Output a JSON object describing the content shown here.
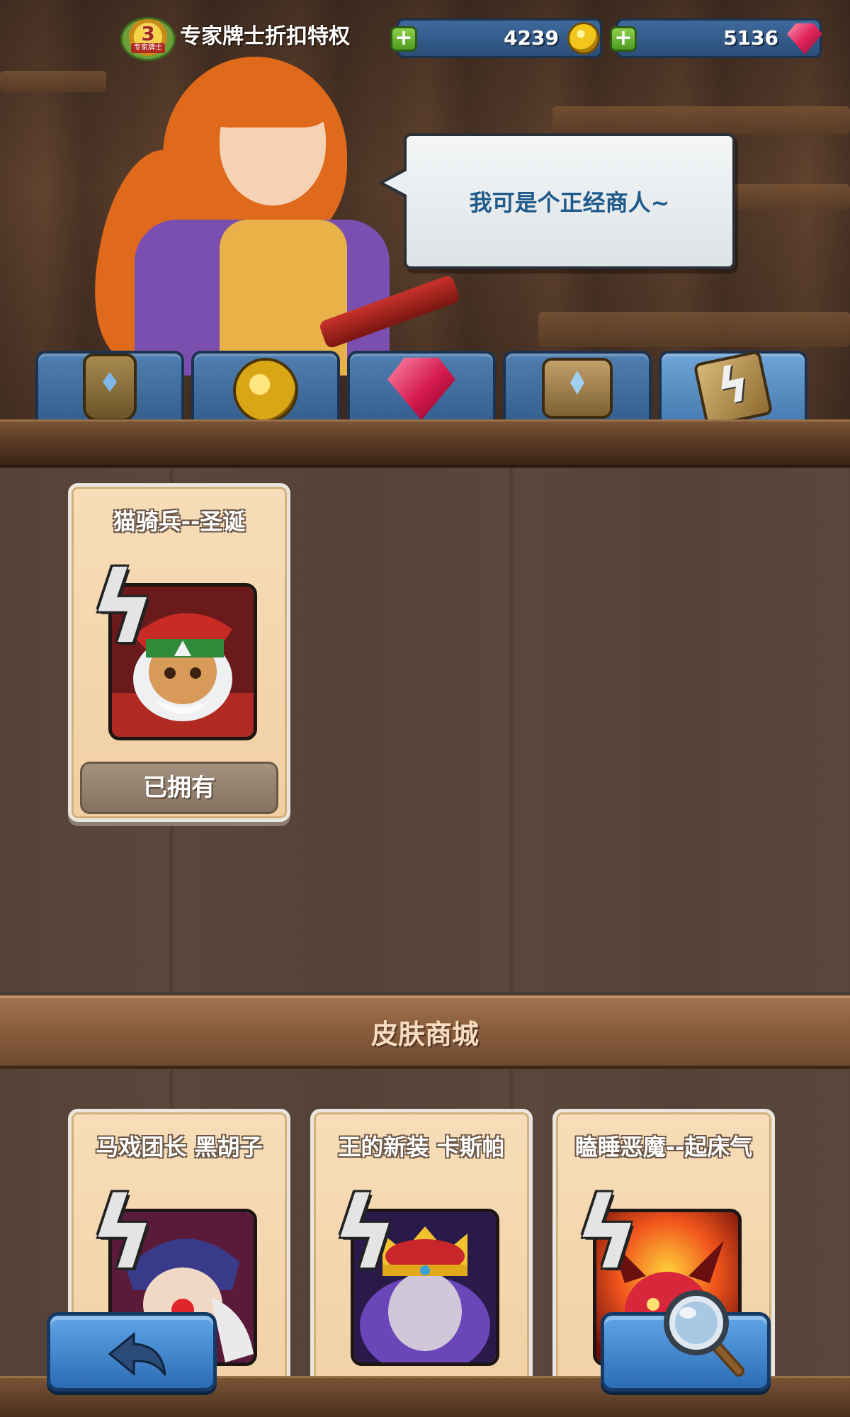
{
  "header": {
    "vip_level": "3",
    "vip_tag": "专家牌士",
    "vip_text": "专家牌士折扣特权",
    "gold": {
      "plus": "+",
      "amount": "4239",
      "icon": "gold-coin-icon"
    },
    "gems": {
      "plus": "+",
      "amount": "5136",
      "icon": "red-gem-icon"
    }
  },
  "merchant": {
    "speech": "我可是个正经商人~"
  },
  "tabs": [
    {
      "name": "pouch-tab",
      "icon": "pouch-icon",
      "active": false
    },
    {
      "name": "coins-tab",
      "icon": "coin-stack-icon",
      "active": false
    },
    {
      "name": "gems-tab",
      "icon": "gem-icon",
      "active": false
    },
    {
      "name": "scroll-tab",
      "icon": "scroll-icon",
      "active": false
    },
    {
      "name": "skin-cards-tab",
      "icon": "skin-card-icon",
      "active": true
    }
  ],
  "owned_skins": [
    {
      "title": "猫骑兵--圣诞",
      "status": "已拥有"
    }
  ],
  "shop": {
    "title": "皮肤商城",
    "items": [
      {
        "title": "马戏团长 黑胡子"
      },
      {
        "title": "王的新装 卡斯帕"
      },
      {
        "title": "瞌睡恶魔--起床气"
      }
    ]
  },
  "nav": {
    "back_icon": "back-arrow-icon",
    "search_icon": "magnifier-icon"
  }
}
